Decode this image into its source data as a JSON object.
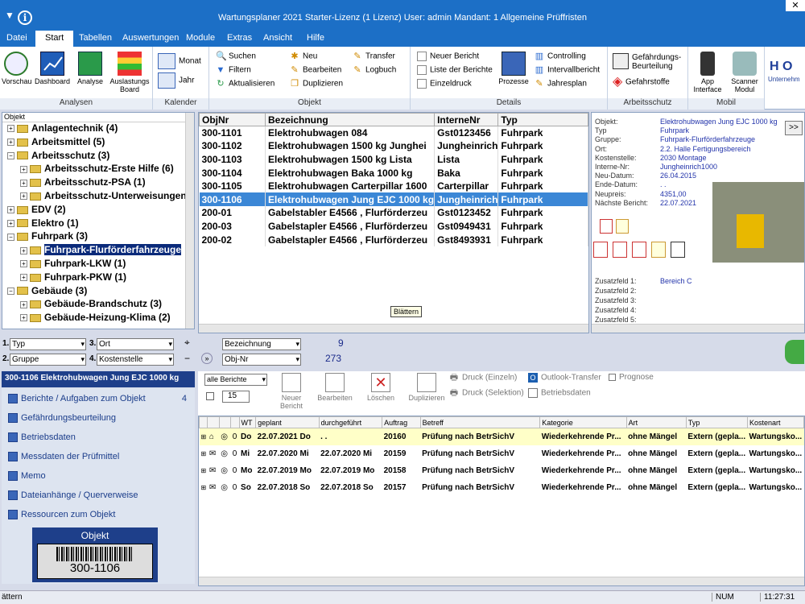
{
  "app": {
    "title": "Wartungsplaner 2021 Starter-Lizenz (1 Lizenz)   User: admin   Mandant: 1 Allgemeine Prüffristen",
    "close": "✕"
  },
  "menu": [
    "Datei",
    "Start",
    "Tabellen",
    "Auswertungen",
    "Module",
    "Extras",
    "Ansicht",
    "Hilfe"
  ],
  "ribbon": {
    "groups": [
      "Analysen",
      "Kalender",
      "Objekt",
      "Details",
      "Arbeitsschutz",
      "Mobil"
    ],
    "analysen": [
      "Vorschau",
      "Dashboard",
      "Analyse",
      "Auslastungs Board"
    ],
    "kalender": [
      "Monat",
      "Jahr"
    ],
    "objekt": [
      "Suchen",
      "Filtern",
      "Aktualisieren",
      "Neu",
      "Bearbeiten",
      "Duplizieren",
      "Transfer",
      "Logbuch"
    ],
    "details": [
      "Neuer Bericht",
      "Liste der Berichte",
      "Einzeldruck",
      "Prozesse",
      "Controlling",
      "Intervallbericht",
      "Jahresplan"
    ],
    "arbeitsschutz": [
      "Gefährdungs-Beurteilung",
      "Gefahrstoffe"
    ],
    "mobil": [
      "App Interface",
      "Scanner Modul"
    ],
    "extra": "H O",
    "extra_sub": "Unternehm"
  },
  "tree": {
    "header": "Objekt",
    "nodes": [
      {
        "label": "Anlagentechnik  (4)",
        "level": 0,
        "pm": "+"
      },
      {
        "label": "Arbeitsmittel  (5)",
        "level": 0,
        "pm": "+"
      },
      {
        "label": "Arbeitsschutz  (3)",
        "level": 0,
        "pm": "−"
      },
      {
        "label": "Arbeitsschutz-Erste Hilfe  (6)",
        "level": 1,
        "pm": "+"
      },
      {
        "label": "Arbeitsschutz-PSA  (1)",
        "level": 1,
        "pm": "+"
      },
      {
        "label": "Arbeitsschutz-Unterweisungen",
        "level": 1,
        "pm": "+"
      },
      {
        "label": "EDV  (2)",
        "level": 0,
        "pm": "+"
      },
      {
        "label": "Elektro  (1)",
        "level": 0,
        "pm": "+"
      },
      {
        "label": "Fuhrpark  (3)",
        "level": 0,
        "pm": "−"
      },
      {
        "label": "Fuhrpark-Flurförderfahrzeuge",
        "level": 1,
        "pm": "+",
        "selected": true
      },
      {
        "label": "Fuhrpark-LKW  (1)",
        "level": 1,
        "pm": "+"
      },
      {
        "label": "Fuhrpark-PKW  (1)",
        "level": 1,
        "pm": "+"
      },
      {
        "label": "Gebäude  (3)",
        "level": 0,
        "pm": "−"
      },
      {
        "label": "Gebäude-Brandschutz  (3)",
        "level": 1,
        "pm": "+"
      },
      {
        "label": "Gebäude-Heizung-Klima  (2)",
        "level": 1,
        "pm": "+"
      }
    ]
  },
  "grid": {
    "columns": [
      "ObjNr",
      "Bezeichnung",
      "InterneNr",
      "Typ"
    ],
    "rows": [
      [
        "300-1101",
        "Elektrohubwagen 084",
        "Gst0123456",
        "Fuhrpark"
      ],
      [
        "300-1102",
        "Elektrohubwagen 1500 kg  Junghei",
        "Jungheinrich",
        "Fuhrpark"
      ],
      [
        "300-1103",
        "Elektrohubwagen 1500 kg Lista",
        "Lista",
        "Fuhrpark"
      ],
      [
        "300-1104",
        "Elektrohubwagen Baka 1000 kg",
        "Baka",
        "Fuhrpark"
      ],
      [
        "300-1105",
        "Elektrohubwagen Carterpillar 1600",
        "Carterpillar",
        "Fuhrpark"
      ],
      [
        "300-1106",
        "Elektrohubwagen Jung EJC 1000 kg",
        "Jungheinrich",
        "Fuhrpark"
      ],
      [
        "200-01",
        "Gabelstabler E4566 , Flurförderzeu",
        "Gst0123452",
        "Fuhrpark"
      ],
      [
        "200-03",
        "Gabelstapler E4566 , Flurförderzeu",
        "Gst0949431",
        "Fuhrpark"
      ],
      [
        "200-02",
        "Gabelstapler E4566 , Flurförderzeu",
        "Gst8493931",
        "Fuhrpark"
      ]
    ],
    "selected_index": 5,
    "tooltip": "Blättern"
  },
  "details": {
    "fields": [
      {
        "label": "Objekt:",
        "value": "Elektrohubwagen Jung EJC 1000 kg"
      },
      {
        "label": "Typ",
        "value": "Fuhrpark"
      },
      {
        "label": "Gruppe:",
        "value": "Fuhrpark-Flurförderfahrzeuge"
      },
      {
        "label": "Ort:",
        "value": "2.2. Halle Fertigungsbereich"
      },
      {
        "label": "Kostenstelle:",
        "value": "2030 Montage"
      },
      {
        "label": "Interne-Nr:",
        "value": "Jungheinrich1000"
      },
      {
        "label": "Neu-Datum:",
        "value": "26.04.2015"
      },
      {
        "label": "Ende-Datum:",
        "value": ". ."
      },
      {
        "label": "Neupreis:",
        "value": "4351,00"
      },
      {
        "label": "Nächste Bericht:",
        "value": "22.07.2021"
      }
    ],
    "zusatz": [
      {
        "label": "Zusatzfeld 1:",
        "value": "Bereich C"
      },
      {
        "label": "Zusatzfeld 2:",
        "value": ""
      },
      {
        "label": "Zusatzfeld 3:",
        "value": ""
      },
      {
        "label": "Zusatzfeld 4:",
        "value": ""
      },
      {
        "label": "Zusatzfeld 5:",
        "value": ""
      }
    ],
    "expand": ">>"
  },
  "filters": {
    "f1_num": "1.",
    "f1": "Typ",
    "f2_num": "2.",
    "f2": "Gruppe",
    "f3_num": "3.",
    "f3": "Ort",
    "f4_num": "4.",
    "f4": "Kostenstelle",
    "sort1": "Bezeichnung",
    "sort1_count": "9",
    "sort2": "Obj-Nr",
    "sort2_count": "273"
  },
  "object_header": "300-1106 Elektrohubwagen Jung EJC 1000 kg",
  "leftnav": [
    {
      "label": "Berichte / Aufgaben zum Objekt",
      "count": "4"
    },
    {
      "label": "Gefährdungsbeurteilung",
      "count": ""
    },
    {
      "label": "Betriebsdaten",
      "count": ""
    },
    {
      "label": "Messdaten der Prüfmittel",
      "count": ""
    },
    {
      "label": "Memo",
      "count": ""
    },
    {
      "label": "Dateianhänge / Querverweise",
      "count": ""
    },
    {
      "label": "Ressourcen zum Objekt",
      "count": ""
    }
  ],
  "barcode": {
    "title": "Objekt",
    "code": "300-1106"
  },
  "reporttools": {
    "select": "alle Berichte",
    "count": "15",
    "buttons": [
      "Neuer Bericht",
      "Bearbeiten",
      "Löschen",
      "Duplizieren"
    ],
    "print_single": "Druck (Einzeln)",
    "print_sel": "Druck (Selektion)",
    "outlook": "Outlook-Transfer",
    "prognose": "Prognose",
    "betriebsdaten": "Betriebsdaten"
  },
  "reports": {
    "columns": [
      "",
      "",
      "",
      "",
      "WT",
      "geplant",
      "durchgeführt",
      "Auftrag",
      "Betreff",
      "Kategorie",
      "Art",
      "Typ",
      "Kostenart"
    ],
    "rows": [
      {
        "wt": "Do",
        "geplant": "22.07.2021 Do",
        "durch": ". .",
        "auftrag": "20160",
        "betreff": "Prüfung nach BetrSichV",
        "kat": "Wiederkehrende Pr...",
        "art": "ohne Mängel",
        "typ": "Extern (gepla...",
        "kost": "Wartungsko...",
        "hl": true
      },
      {
        "wt": "Mi",
        "geplant": "22.07.2020 Mi",
        "durch": "22.07.2020 Mi",
        "auftrag": "20159",
        "betreff": "Prüfung nach BetrSichV",
        "kat": "Wiederkehrende Pr...",
        "art": "ohne Mängel",
        "typ": "Extern (gepla...",
        "kost": "Wartungsko..."
      },
      {
        "wt": "Mo",
        "geplant": "22.07.2019 Mo",
        "durch": "22.07.2019 Mo",
        "auftrag": "20158",
        "betreff": "Prüfung nach BetrSichV",
        "kat": "Wiederkehrende Pr...",
        "art": "ohne Mängel",
        "typ": "Extern (gepla...",
        "kost": "Wartungsko..."
      },
      {
        "wt": "So",
        "geplant": "22.07.2018 So",
        "durch": "22.07.2018 So",
        "auftrag": "20157",
        "betreff": "Prüfung nach BetrSichV",
        "kat": "Wiederkehrende Pr...",
        "art": "ohne Mängel",
        "typ": "Extern (gepla...",
        "kost": "Wartungsko..."
      }
    ]
  },
  "status": {
    "left": "ättern",
    "num": "NUM",
    "time": "11:27:31"
  }
}
